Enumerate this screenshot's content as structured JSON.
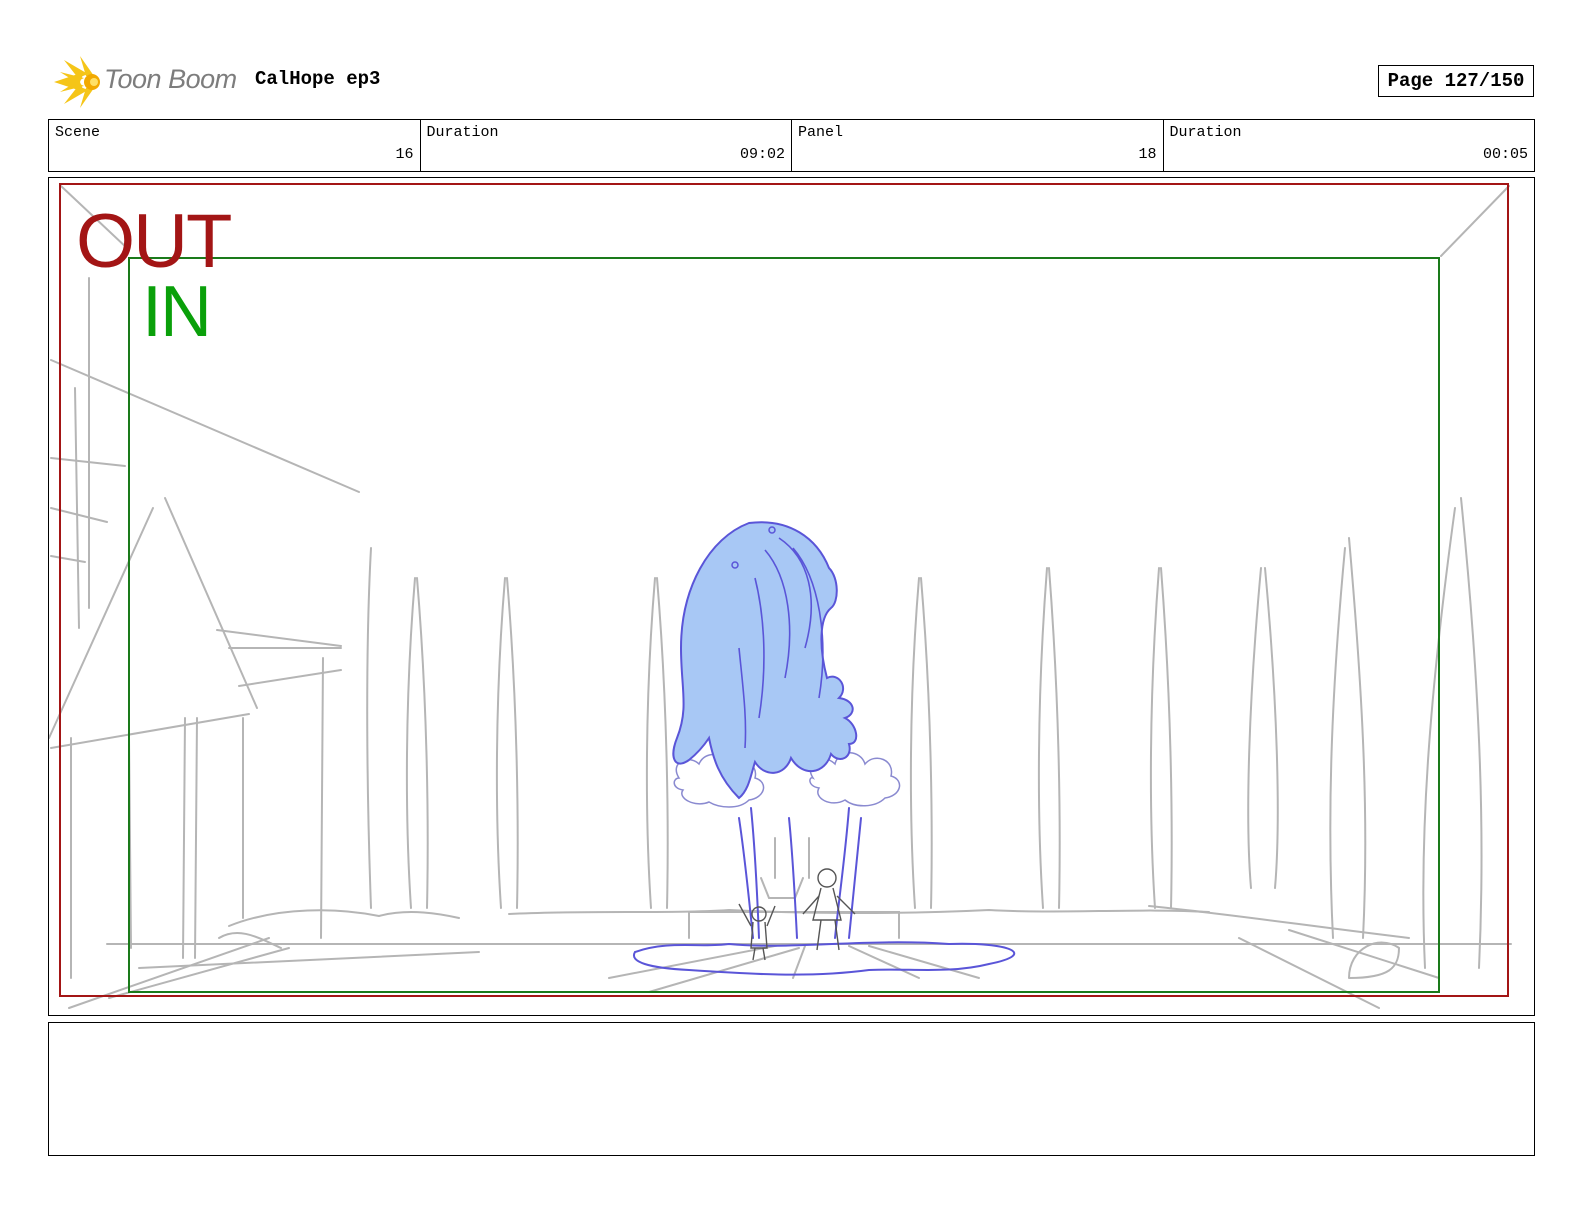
{
  "header": {
    "logo_text": "Toon Boom",
    "project_title": "CalHope ep3",
    "page_label": "Page 127/150"
  },
  "info": {
    "scene_label": "Scene",
    "scene_value": "16",
    "scene_duration_label": "Duration",
    "scene_duration_value": "09:02",
    "panel_label": "Panel",
    "panel_value": "18",
    "panel_duration_label": "Duration",
    "panel_duration_value": "00:05"
  },
  "panel_frame": {
    "out_label": "OUT",
    "in_label": "IN",
    "out_color": "#a31515",
    "in_color": "#0aa00a",
    "subject_fill": "#a8c8f5",
    "subject_line": "#5a55d8",
    "sketch_line": "#b5b5b5"
  },
  "notes": {
    "text": ""
  }
}
